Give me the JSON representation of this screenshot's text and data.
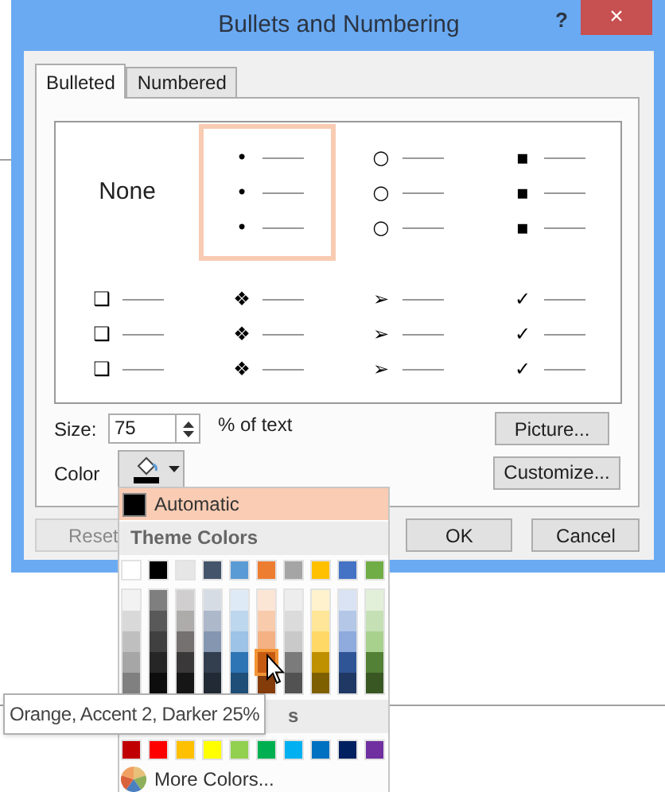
{
  "window": {
    "title": "Bullets and Numbering",
    "help": "?",
    "close": "×"
  },
  "tabs": [
    {
      "label": "Bulleted",
      "selected": true
    },
    {
      "label": "Numbered",
      "selected": false
    }
  ],
  "gallery": [
    {
      "kind": "none",
      "label": "None",
      "selected": false
    },
    {
      "kind": "bullet",
      "symbol": "•",
      "selected": true
    },
    {
      "kind": "bullet",
      "symbol": "○",
      "selected": false
    },
    {
      "kind": "bullet",
      "symbol": "▪",
      "selected": false
    },
    {
      "kind": "bullet",
      "symbol": "❑",
      "selected": false
    },
    {
      "kind": "bullet",
      "symbol": "❖",
      "selected": false
    },
    {
      "kind": "bullet",
      "symbol": "➢",
      "selected": false
    },
    {
      "kind": "bullet",
      "symbol": "✓",
      "selected": false
    }
  ],
  "size": {
    "label": "Size:",
    "value": "75",
    "unit": "% of text"
  },
  "color": {
    "label": "Color"
  },
  "buttons": {
    "picture": "Picture...",
    "customize": "Customize..."
  },
  "footer_buttons": [
    "Reset",
    "OK",
    "Cancel"
  ],
  "color_menu": {
    "automatic": {
      "label": "Automatic",
      "selected": true
    },
    "theme_header": "Theme Colors",
    "theme_colors": [
      {
        "color": "#ffffff",
        "hovered": false,
        "shades": [
          {
            "color": "#f2f2f2",
            "hovered": false
          },
          {
            "color": "#d9d9d9",
            "hovered": false
          },
          {
            "color": "#bfbfbf",
            "hovered": false
          },
          {
            "color": "#a6a6a6",
            "hovered": false
          },
          {
            "color": "#808080",
            "hovered": false
          }
        ]
      },
      {
        "color": "#000000",
        "hovered": false,
        "shades": [
          {
            "color": "#7f7f7f",
            "hovered": false
          },
          {
            "color": "#595959",
            "hovered": false
          },
          {
            "color": "#404040",
            "hovered": false
          },
          {
            "color": "#262626",
            "hovered": false
          },
          {
            "color": "#0d0d0d",
            "hovered": false
          }
        ]
      },
      {
        "color": "#e7e6e6",
        "hovered": false,
        "shades": [
          {
            "color": "#d0cece",
            "hovered": false
          },
          {
            "color": "#aeabab",
            "hovered": false
          },
          {
            "color": "#757171",
            "hovered": false
          },
          {
            "color": "#3a3838",
            "hovered": false
          },
          {
            "color": "#171616",
            "hovered": false
          }
        ]
      },
      {
        "color": "#44546a",
        "hovered": false,
        "shades": [
          {
            "color": "#d6dce4",
            "hovered": false
          },
          {
            "color": "#adb9ca",
            "hovered": false
          },
          {
            "color": "#8496b0",
            "hovered": false
          },
          {
            "color": "#333f4f",
            "hovered": false
          },
          {
            "color": "#222a35",
            "hovered": false
          }
        ]
      },
      {
        "color": "#5b9bd5",
        "hovered": false,
        "shades": [
          {
            "color": "#deebf6",
            "hovered": false
          },
          {
            "color": "#bdd7ee",
            "hovered": false
          },
          {
            "color": "#9dc3e6",
            "hovered": false
          },
          {
            "color": "#2e75b5",
            "hovered": false
          },
          {
            "color": "#1f4e79",
            "hovered": false
          }
        ]
      },
      {
        "color": "#ed7d31",
        "hovered": false,
        "shades": [
          {
            "color": "#fbe5d5",
            "hovered": false
          },
          {
            "color": "#f8cbad",
            "hovered": false
          },
          {
            "color": "#f4b183",
            "hovered": false
          },
          {
            "color": "#c55a11",
            "hovered": true
          },
          {
            "color": "#843c0b",
            "hovered": false
          }
        ]
      },
      {
        "color": "#a5a5a5",
        "hovered": false,
        "shades": [
          {
            "color": "#ededed",
            "hovered": false
          },
          {
            "color": "#dbdbdb",
            "hovered": false
          },
          {
            "color": "#c9c9c9",
            "hovered": false
          },
          {
            "color": "#7b7b7b",
            "hovered": false
          },
          {
            "color": "#525252",
            "hovered": false
          }
        ]
      },
      {
        "color": "#ffc000",
        "hovered": false,
        "shades": [
          {
            "color": "#fff2cc",
            "hovered": false
          },
          {
            "color": "#ffe699",
            "hovered": false
          },
          {
            "color": "#ffd966",
            "hovered": false
          },
          {
            "color": "#bf9000",
            "hovered": false
          },
          {
            "color": "#7f6000",
            "hovered": false
          }
        ]
      },
      {
        "color": "#4472c4",
        "hovered": false,
        "shades": [
          {
            "color": "#dae3f3",
            "hovered": false
          },
          {
            "color": "#b4c7e7",
            "hovered": false
          },
          {
            "color": "#8faadc",
            "hovered": false
          },
          {
            "color": "#2f5597",
            "hovered": false
          },
          {
            "color": "#203864",
            "hovered": false
          }
        ]
      },
      {
        "color": "#70ad47",
        "hovered": false,
        "shades": [
          {
            "color": "#e2f0d9",
            "hovered": false
          },
          {
            "color": "#c5e0b4",
            "hovered": false
          },
          {
            "color": "#a9d18e",
            "hovered": false
          },
          {
            "color": "#538135",
            "hovered": false
          },
          {
            "color": "#385723",
            "hovered": false
          }
        ]
      }
    ],
    "standard_header": "s",
    "standard_colors": [
      {
        "color": "#c00000",
        "hovered": false
      },
      {
        "color": "#ff0000",
        "hovered": false
      },
      {
        "color": "#ffc000",
        "hovered": false
      },
      {
        "color": "#ffff00",
        "hovered": false
      },
      {
        "color": "#92d050",
        "hovered": false
      },
      {
        "color": "#00b050",
        "hovered": false
      },
      {
        "color": "#00b0f0",
        "hovered": false
      },
      {
        "color": "#0070c0",
        "hovered": false
      },
      {
        "color": "#002060",
        "hovered": false
      },
      {
        "color": "#7030a0",
        "hovered": false
      }
    ],
    "more": "More Colors..."
  },
  "tooltip": "Orange, Accent 2, Darker 25%"
}
